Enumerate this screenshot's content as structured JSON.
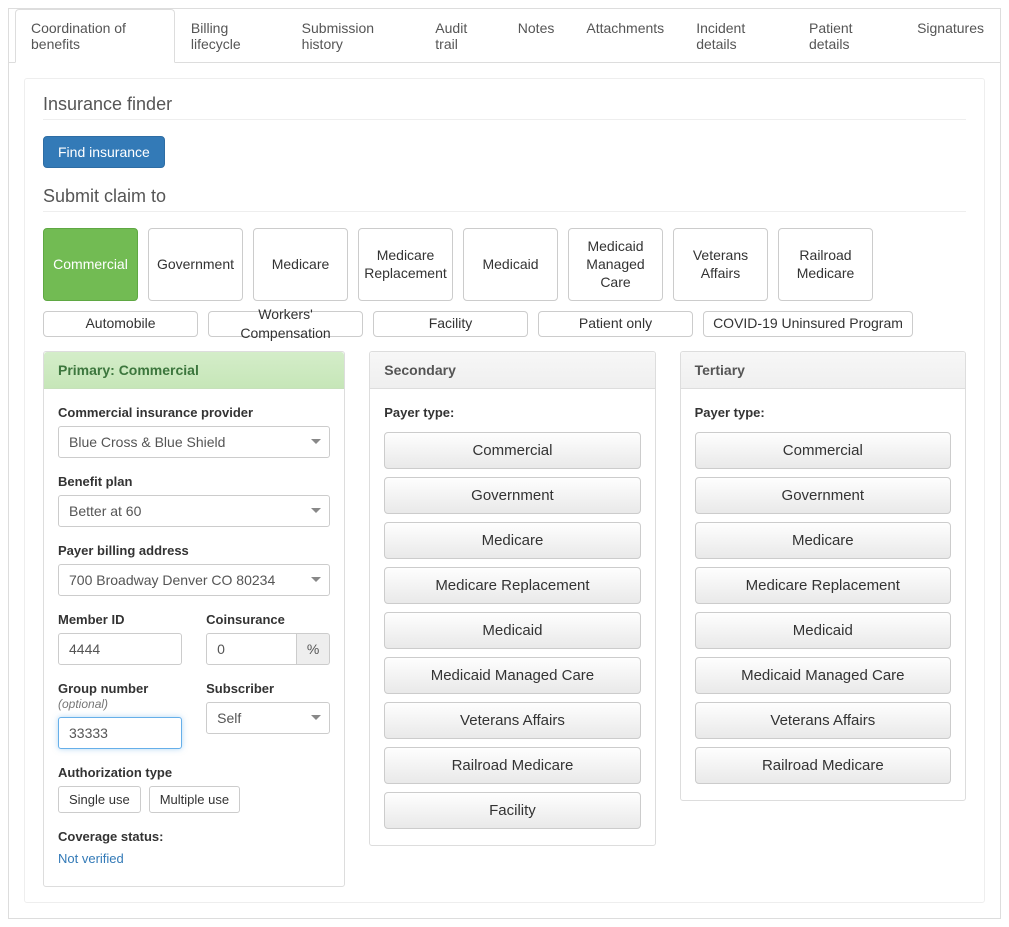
{
  "tabs": [
    {
      "label": "Coordination of benefits",
      "active": true
    },
    {
      "label": "Billing lifecycle",
      "active": false
    },
    {
      "label": "Submission history",
      "active": false
    },
    {
      "label": "Audit trail",
      "active": false
    },
    {
      "label": "Notes",
      "active": false
    },
    {
      "label": "Attachments",
      "active": false
    },
    {
      "label": "Incident details",
      "active": false
    },
    {
      "label": "Patient details",
      "active": false
    },
    {
      "label": "Signatures",
      "active": false
    }
  ],
  "insuranceFinder": {
    "title": "Insurance finder",
    "findButton": "Find insurance"
  },
  "submitClaim": {
    "title": "Submit claim to",
    "row1": [
      {
        "label": "Commercial",
        "selected": true
      },
      {
        "label": "Government",
        "selected": false
      },
      {
        "label": "Medicare",
        "selected": false
      },
      {
        "label": "Medicare Replacement",
        "selected": false
      },
      {
        "label": "Medicaid",
        "selected": false
      },
      {
        "label": "Medicaid Managed Care",
        "selected": false
      },
      {
        "label": "Veterans Affairs",
        "selected": false
      },
      {
        "label": "Railroad Medicare",
        "selected": false
      }
    ],
    "row2": [
      {
        "label": "Automobile"
      },
      {
        "label": "Workers' Compensation"
      },
      {
        "label": "Facility"
      },
      {
        "label": "Patient only"
      },
      {
        "label": "COVID-19 Uninsured Program"
      }
    ]
  },
  "primary": {
    "header": "Primary: Commercial",
    "providerLabel": "Commercial insurance provider",
    "providerValue": "Blue Cross & Blue Shield",
    "planLabel": "Benefit plan",
    "planValue": "Better at 60",
    "billingLabel": "Payer billing address",
    "billingValue": "700 Broadway Denver CO 80234",
    "memberIdLabel": "Member ID",
    "memberIdValue": "4444",
    "coinsuranceLabel": "Coinsurance",
    "coinsuranceValue": "0",
    "coinsuranceUnit": "%",
    "groupLabel": "Group number",
    "groupOptional": "(optional)",
    "groupValue": "33333",
    "subscriberLabel": "Subscriber",
    "subscriberValue": "Self",
    "authLabel": "Authorization type",
    "authSingle": "Single use",
    "authMultiple": "Multiple use",
    "coverageLabel": "Coverage status:",
    "coverageValue": "Not verified"
  },
  "secondary": {
    "header": "Secondary",
    "payerTypeLabel": "Payer type:",
    "options": [
      "Commercial",
      "Government",
      "Medicare",
      "Medicare Replacement",
      "Medicaid",
      "Medicaid Managed Care",
      "Veterans Affairs",
      "Railroad Medicare",
      "Facility"
    ]
  },
  "tertiary": {
    "header": "Tertiary",
    "payerTypeLabel": "Payer type:",
    "options": [
      "Commercial",
      "Government",
      "Medicare",
      "Medicare Replacement",
      "Medicaid",
      "Medicaid Managed Care",
      "Veterans Affairs",
      "Railroad Medicare"
    ]
  }
}
